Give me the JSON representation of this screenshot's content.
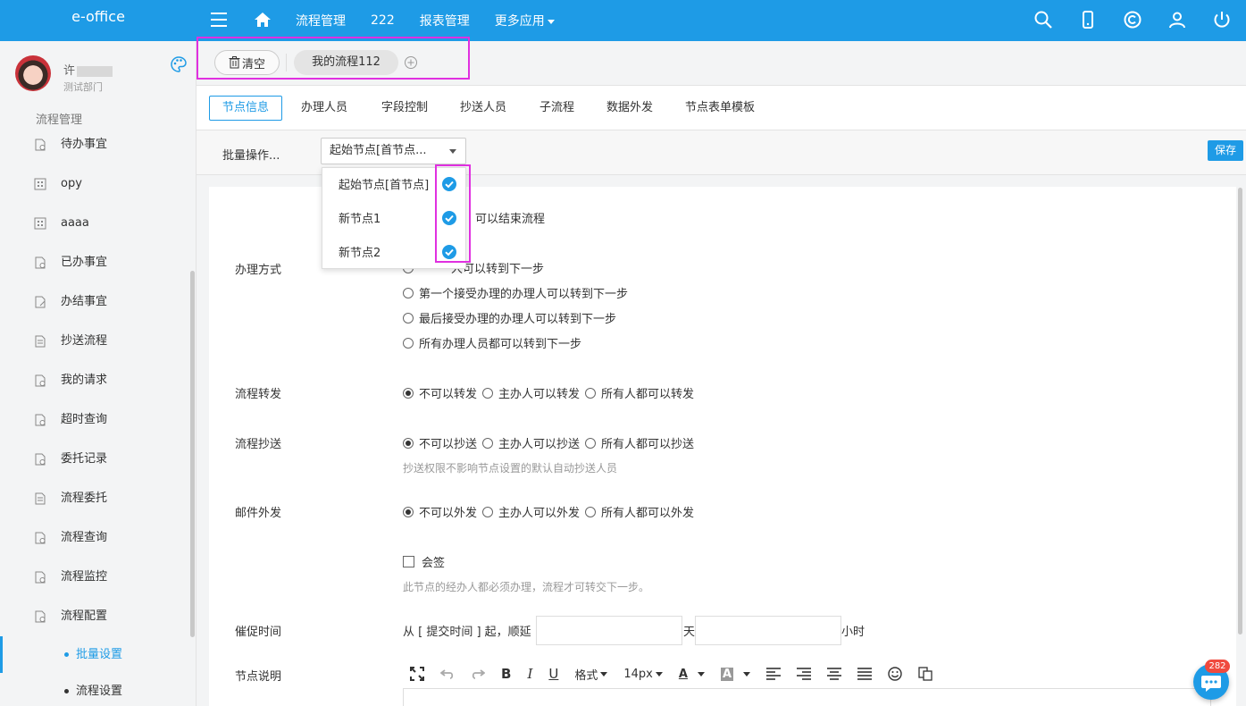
{
  "topbar": {
    "brand": "e-office",
    "nav": [
      "流程管理",
      "222",
      "报表管理",
      "更多应用"
    ],
    "icons": [
      "search-icon",
      "mobile-icon",
      "copyright-icon",
      "user-icon",
      "power-icon"
    ]
  },
  "user": {
    "name_prefix": "许",
    "department": "测试部门"
  },
  "sidebar": {
    "section": "流程管理",
    "items": [
      "待办事宜",
      "opy",
      "aaaa",
      "已办事宜",
      "办结事宜",
      "抄送流程",
      "我的请求",
      "超时查询",
      "委托记录",
      "流程委托",
      "流程查询",
      "流程监控",
      "流程配置"
    ],
    "sub_items": [
      "批量设置",
      "流程设置"
    ],
    "active_sub": "批量设置"
  },
  "tabs": {
    "clear_label": "清空",
    "flow_tab": "我的流程112"
  },
  "subtabs": [
    "节点信息",
    "办理人员",
    "字段控制",
    "抄送人员",
    "子流程",
    "数据外发",
    "节点表单模板"
  ],
  "batch": {
    "label": "批量操作...",
    "selected": "起始节点[首节点...",
    "save": "保存",
    "options": [
      "起始节点[首节点]",
      "新节点1",
      "新节点2"
    ]
  },
  "form": {
    "end_flow_partial": "可以结束流程",
    "handle_label": "办理方式",
    "handle_options": [
      "只有主办人可以转到下一步",
      "第一个接受办理的办理人可以转到下一步",
      "最后接受办理的办理人可以转到下一步",
      "所有办理人员都可以转到下一步"
    ],
    "handle_visible_partial": "人可以转到下一步",
    "forward_label": "流程转发",
    "forward_options": [
      "不可以转发",
      "主办人可以转发",
      "所有人都可以转发"
    ],
    "cc_label": "流程抄送",
    "cc_options": [
      "不可以抄送",
      "主办人可以抄送",
      "所有人都可以抄送"
    ],
    "cc_hint": "抄送权限不影响节点设置的默认自动抄送人员",
    "mail_label": "邮件外发",
    "mail_options": [
      "不可以外发",
      "主办人可以外发",
      "所有人都可以外发"
    ],
    "countersign": "会签",
    "countersign_hint": "此节点的经办人都必须办理，流程才可转交下一步。",
    "urge_label": "催促时间",
    "urge_prefix": "从 [ 提交时间 ] 起，顺延",
    "urge_day": "天",
    "urge_hour": "小时",
    "desc_label": "节点说明"
  },
  "editor": {
    "format": "格式",
    "size": "14px"
  },
  "chat": {
    "badge": "282"
  }
}
